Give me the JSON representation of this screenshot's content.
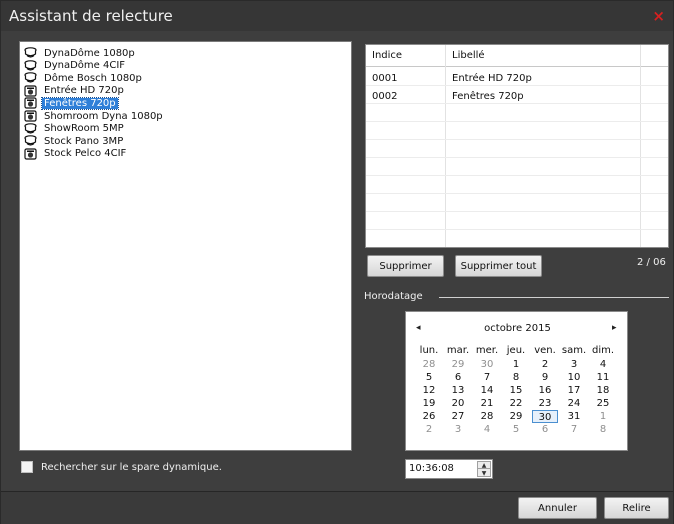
{
  "window": {
    "title": "Assistant de relecture",
    "close_icon": "close-icon",
    "close_glyph": "×"
  },
  "cameras": [
    {
      "label": "DynaDôme 1080p",
      "icon": "dome-camera-icon",
      "selected": false
    },
    {
      "label": "DynaDôme 4CIF",
      "icon": "dome-camera-icon",
      "selected": false
    },
    {
      "label": "Dôme Bosch 1080p",
      "icon": "dome-camera-icon",
      "selected": false
    },
    {
      "label": "Entrée HD 720p",
      "icon": "box-camera-icon",
      "selected": false
    },
    {
      "label": "Fenêtres 720p",
      "icon": "box-camera-icon",
      "selected": true
    },
    {
      "label": "Shomroom Dyna 1080p",
      "icon": "box-camera-icon",
      "selected": false
    },
    {
      "label": "ShowRoom 5MP",
      "icon": "dome-camera-icon",
      "selected": false
    },
    {
      "label": "Stock Pano 3MP",
      "icon": "dome-camera-icon",
      "selected": false
    },
    {
      "label": "Stock Pelco 4CIF",
      "icon": "box-camera-icon",
      "selected": false
    }
  ],
  "table": {
    "columns": [
      "Indice",
      "Libellé"
    ],
    "rows": [
      [
        "0001",
        "Entrée HD 720p"
      ],
      [
        "0002",
        "Fenêtres 720p"
      ]
    ]
  },
  "buttons": {
    "delete": "Supprimer",
    "delete_all": "Supprimer tout",
    "cancel": "Annuler",
    "replay": "Relire"
  },
  "counter": "2 / 06",
  "timestamp_section": "Horodatage",
  "calendar": {
    "month_label": "octobre 2015",
    "prev_glyph": "◂",
    "next_glyph": "▸",
    "weekdays": [
      "lun.",
      "mar.",
      "mer.",
      "jeu.",
      "ven.",
      "sam.",
      "dim."
    ],
    "weeks": [
      [
        "28",
        "29",
        "30",
        "1",
        "2",
        "3",
        "4"
      ],
      [
        "5",
        "6",
        "7",
        "8",
        "9",
        "10",
        "11"
      ],
      [
        "12",
        "13",
        "14",
        "15",
        "16",
        "17",
        "18"
      ],
      [
        "19",
        "20",
        "21",
        "22",
        "23",
        "24",
        "25"
      ],
      [
        "26",
        "27",
        "28",
        "29",
        "30",
        "31",
        "1"
      ],
      [
        "2",
        "3",
        "4",
        "5",
        "6",
        "7",
        "8"
      ]
    ],
    "selected_day": "30"
  },
  "time": {
    "value": "10:36:08",
    "up_glyph": "▲",
    "down_glyph": "▼"
  },
  "checkbox": {
    "label": "Rechercher sur le spare dynamique.",
    "checked": false
  },
  "colors": {
    "selection": "#2f7fd8",
    "close": "#d62020",
    "background": "#3e3e3e"
  }
}
